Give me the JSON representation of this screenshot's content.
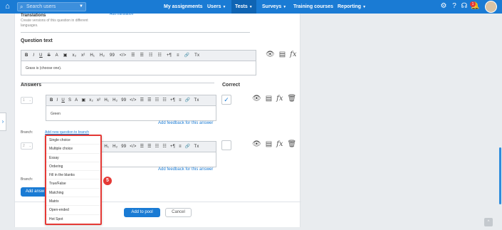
{
  "topbar": {
    "search_placeholder": "Search users",
    "nav": [
      "My assignments",
      "Users",
      "Tests",
      "Surveys",
      "Training courses",
      "Reporting"
    ],
    "notification_count": "1"
  },
  "translations": {
    "title": "Translations",
    "add_link": "Add translation",
    "desc_line1": "Create versions of this question in different",
    "desc_line2": "languages."
  },
  "question": {
    "title": "Question text",
    "content": "Grass is (choose one)."
  },
  "toolbar_buttons": [
    "B",
    "I",
    "U",
    "S",
    "A",
    "▣",
    "x₂",
    "x²",
    "H₁",
    "H₂",
    "99",
    "</>",
    "☰",
    "☰",
    "☷",
    "☷",
    "+¶",
    "≡",
    "🔗",
    "Tx"
  ],
  "answers": {
    "title": "Answers",
    "correct_label": "Correct",
    "answer1": {
      "index": "1",
      "content": "Green"
    },
    "answer2": {
      "index": "2"
    },
    "feedback_link": "Add feedback for this answer",
    "branch_label": "Branch:",
    "branch_link": "Add new question to branch",
    "add_answer": "Add answ"
  },
  "dropdown": {
    "items": [
      "Single choice",
      "Multiple choice",
      "Essay",
      "Ordering",
      "Fill in the blanks",
      "True/False",
      "Matching",
      "Matrix",
      "Open-ended",
      "Hot Spot"
    ]
  },
  "step_number": "5",
  "footer": {
    "add_to_pool": "Add to pool",
    "cancel": "Cancel"
  },
  "colors": {
    "accent": "#1a7bd4",
    "highlight": "#e53935"
  }
}
